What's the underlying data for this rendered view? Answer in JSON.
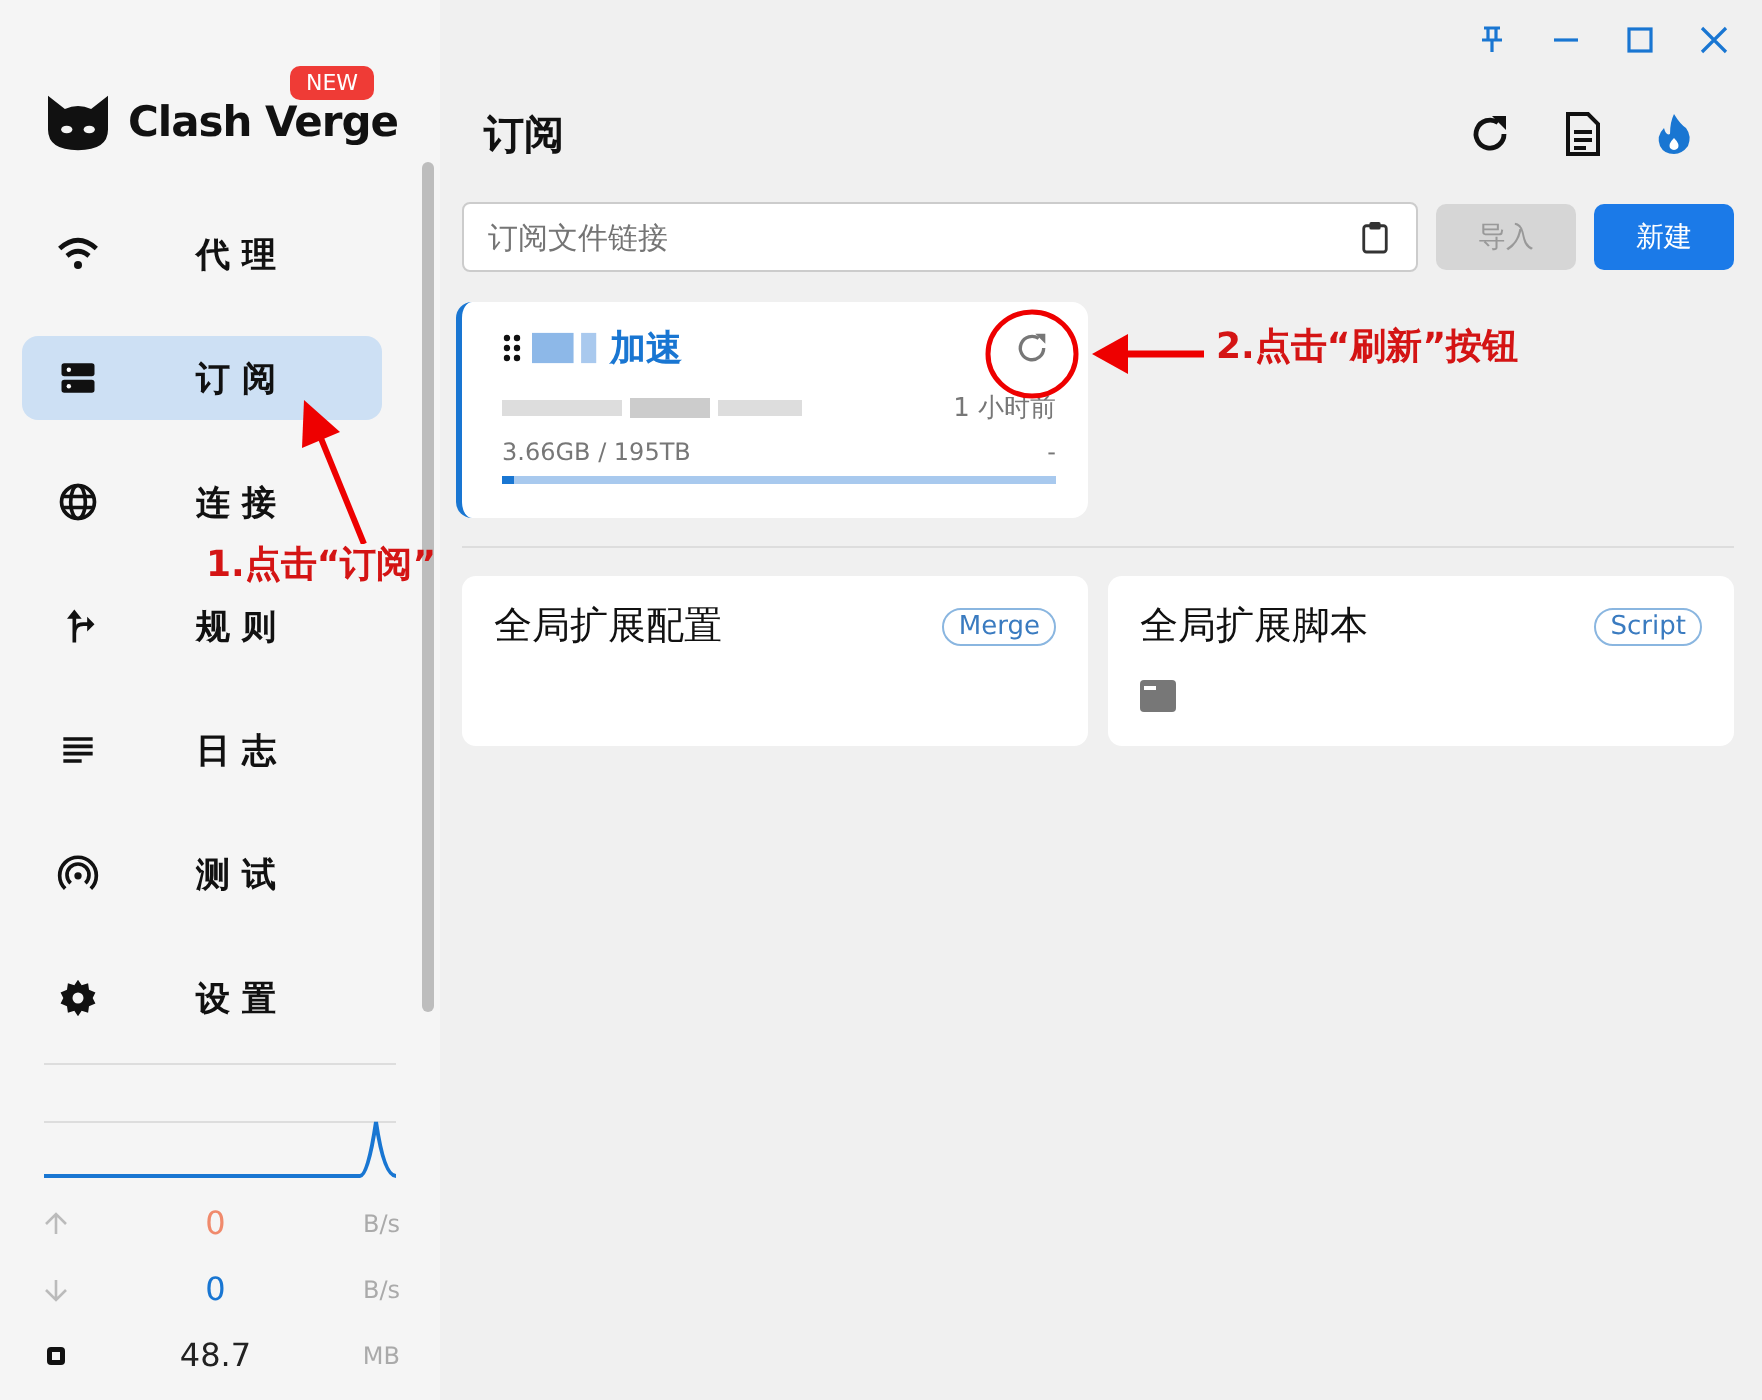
{
  "app": {
    "name": "Clash Verge",
    "badge": "NEW"
  },
  "sidebar": {
    "items": [
      {
        "label": "代 理",
        "selected": false
      },
      {
        "label": "订 阅",
        "selected": true
      },
      {
        "label": "连 接",
        "selected": false
      },
      {
        "label": "规 则",
        "selected": false
      },
      {
        "label": "日 志",
        "selected": false
      },
      {
        "label": "测 试",
        "selected": false
      },
      {
        "label": "设 置",
        "selected": false
      }
    ]
  },
  "traffic": {
    "upload": {
      "value": "0",
      "unit": "B/s"
    },
    "download": {
      "value": "0",
      "unit": "B/s"
    },
    "memory": {
      "value": "48.7",
      "unit": "MB"
    }
  },
  "header": {
    "title": "订阅"
  },
  "import_bar": {
    "placeholder": "订阅文件链接",
    "import_button": {
      "label": "导入",
      "disabled": true
    },
    "new_button": {
      "label": "新建",
      "disabled": false
    }
  },
  "profiles": [
    {
      "name": "加速",
      "updated": "1 小时前",
      "usage": "3.66GB / 195TB",
      "expire": "-",
      "level": 0.02,
      "selected": true
    }
  ],
  "extensions": [
    {
      "title": "全局扩展配置",
      "tag": "Merge",
      "has_script_icon": false
    },
    {
      "title": "全局扩展脚本",
      "tag": "Script",
      "has_script_icon": true
    }
  ],
  "annotations": [
    {
      "text": "1.点击“订阅”"
    },
    {
      "text": "2.点击“刷新”按钮"
    }
  ]
}
